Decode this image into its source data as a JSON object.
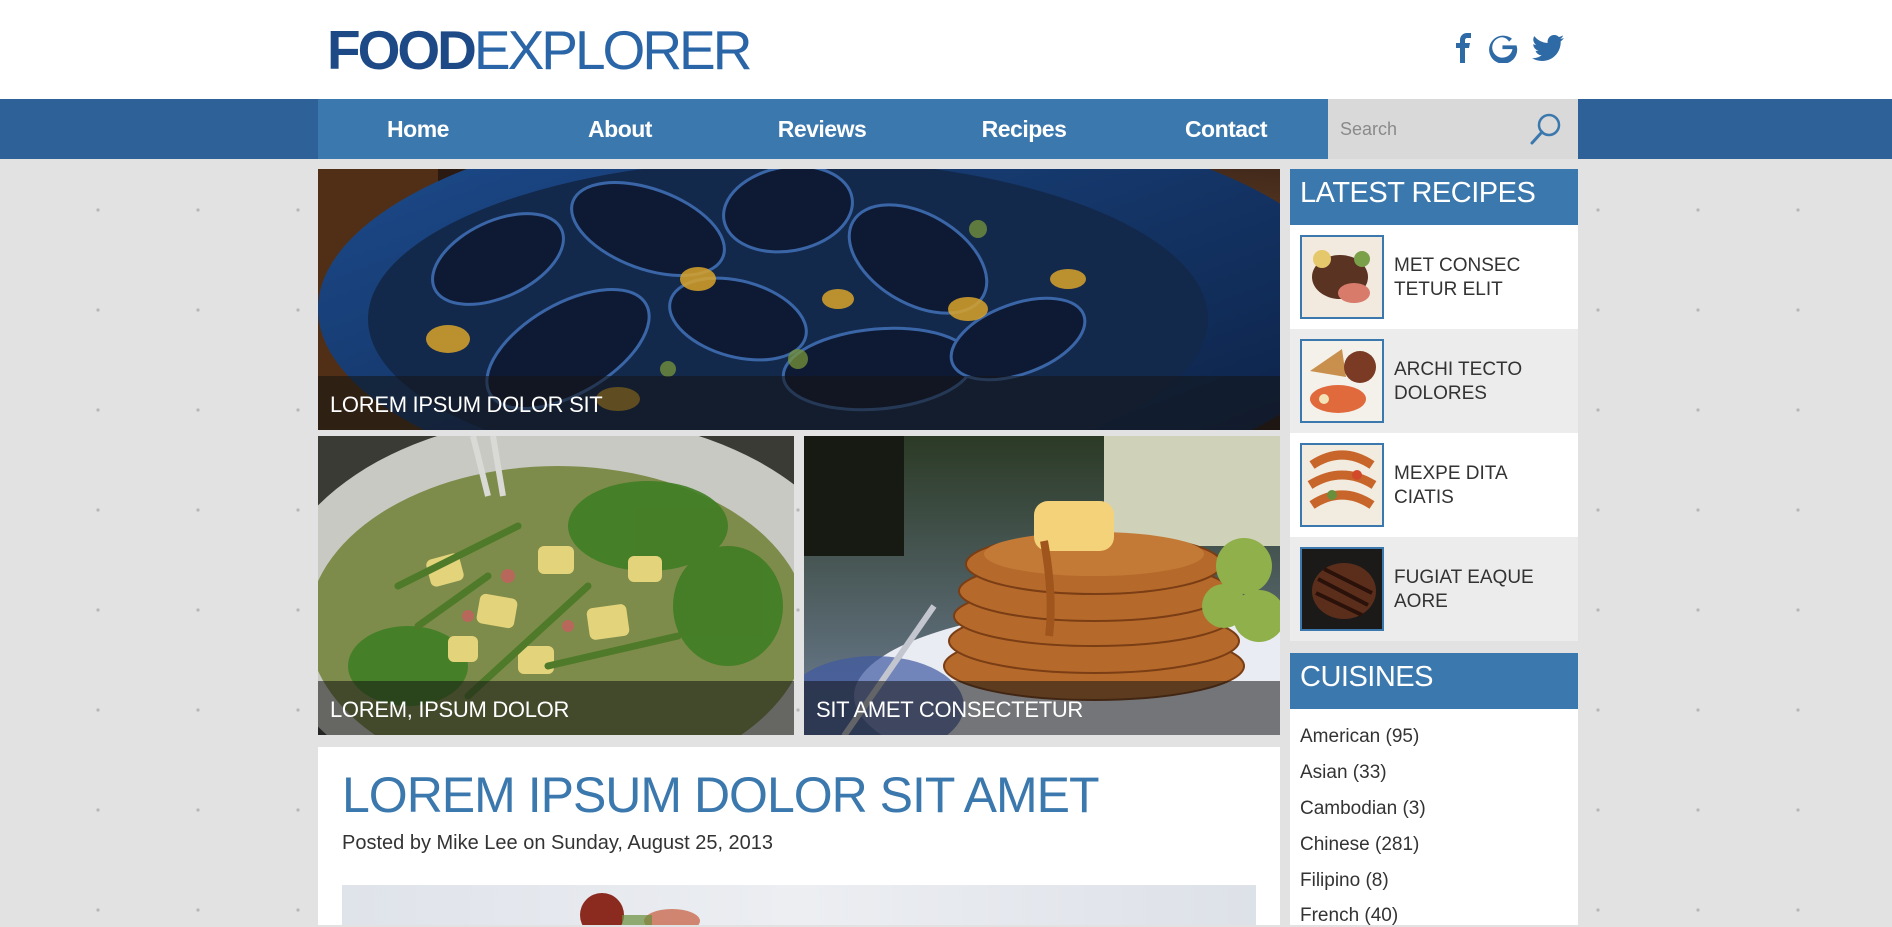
{
  "brand": {
    "logo_bold": "FOOD",
    "logo_light": "EXPLORER",
    "color_primary": "#3b78ad",
    "color_dark": "#2d6198"
  },
  "social": [
    {
      "name": "facebook-icon"
    },
    {
      "name": "google-icon"
    },
    {
      "name": "twitter-icon"
    }
  ],
  "nav": {
    "items": [
      {
        "label": "Home"
      },
      {
        "label": "About"
      },
      {
        "label": "Reviews"
      },
      {
        "label": "Recipes"
      },
      {
        "label": "Contact"
      }
    ],
    "search_placeholder": "Search"
  },
  "features": {
    "hero_caption": "LOREM IPSUM DOLOR SIT",
    "left_caption": "LOREM, IPSUM DOLOR",
    "right_caption": "SIT AMET CONSECTETUR"
  },
  "article": {
    "title": "LOREM IPSUM DOLOR SIT AMET",
    "meta": "Posted by Mike Lee on Sunday, August 25, 2013"
  },
  "sidebar": {
    "latest_heading": "LATEST RECIPES",
    "recipes": [
      {
        "title": "MET CONSEC TETUR ELIT"
      },
      {
        "title": "ARCHI TECTO DOLORES"
      },
      {
        "title": "MEXPE DITA CIATIS"
      },
      {
        "title": "FUGIAT EAQUE AORE"
      }
    ],
    "cuisines_heading": "CUISINES",
    "cuisines": [
      {
        "label": "American (95)"
      },
      {
        "label": "Asian (33)"
      },
      {
        "label": "Cambodian (3)"
      },
      {
        "label": "Chinese (281)"
      },
      {
        "label": "Filipino (8)"
      },
      {
        "label": "French (40)"
      }
    ]
  }
}
